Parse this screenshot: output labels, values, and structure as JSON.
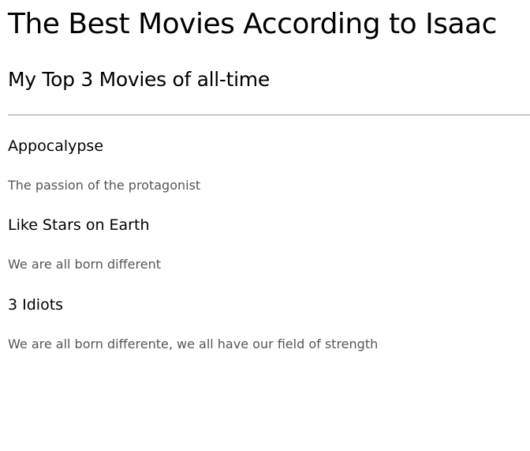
{
  "page": {
    "title": "The Best Movies According to Isaac",
    "subtitle": "My Top 3 Movies of all-time"
  },
  "movies": [
    {
      "title": "Appocalypse",
      "description": "The passion of the protagonist"
    },
    {
      "title": "Like Stars on Earth",
      "description": "We are all born different"
    },
    {
      "title": "3 Idiots",
      "description": "We are all born differente, we all have our field of strength"
    }
  ]
}
